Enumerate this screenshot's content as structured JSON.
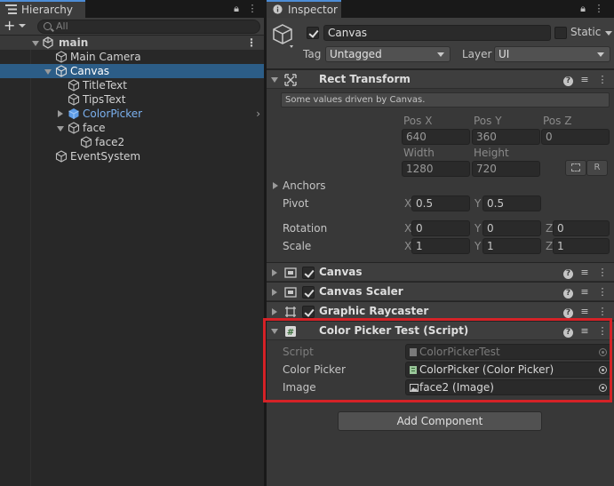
{
  "hierarchy": {
    "tab_label": "Hierarchy",
    "search_placeholder": "All",
    "scene": {
      "name": "main"
    },
    "items": [
      {
        "label": "Main Camera"
      },
      {
        "label": "Canvas"
      },
      {
        "label": "TitleText"
      },
      {
        "label": "TipsText"
      },
      {
        "label": "ColorPicker"
      },
      {
        "label": "face"
      },
      {
        "label": "face2"
      },
      {
        "label": "EventSystem"
      }
    ]
  },
  "inspector": {
    "tab_label": "Inspector",
    "object": {
      "name": "Canvas",
      "active": true,
      "static_label": "Static",
      "tag_label": "Tag",
      "tag_value": "Untagged",
      "layer_label": "Layer",
      "layer_value": "UI"
    },
    "rect_transform": {
      "title": "Rect Transform",
      "info": "Some values driven by Canvas.",
      "pos_x_label": "Pos X",
      "pos_x": "640",
      "pos_y_label": "Pos Y",
      "pos_y": "360",
      "pos_z_label": "Pos Z",
      "pos_z": "0",
      "width_label": "Width",
      "width": "1280",
      "height_label": "Height",
      "height": "720",
      "r_button": "R",
      "anchors_label": "Anchors",
      "pivot_label": "Pivot",
      "pivot_x": "0.5",
      "pivot_y": "0.5",
      "rotation_label": "Rotation",
      "rot_x": "0",
      "rot_y": "0",
      "rot_z": "0",
      "scale_label": "Scale",
      "scale_x": "1",
      "scale_y": "1",
      "scale_z": "1",
      "axis_x": "X",
      "axis_y": "Y",
      "axis_z": "Z"
    },
    "components": [
      {
        "title": "Canvas"
      },
      {
        "title": "Canvas Scaler"
      },
      {
        "title": "Graphic Raycaster"
      }
    ],
    "script_component": {
      "title": "Color Picker Test (Script)",
      "script_label": "Script",
      "script_value": "ColorPickerTest",
      "color_picker_label": "Color Picker",
      "color_picker_value": "ColorPicker (Color Picker)",
      "image_label": "Image",
      "image_value": "face2 (Image)"
    },
    "add_component_label": "Add Component"
  },
  "colors": {
    "selection": "#2c5d87",
    "highlight_border": "#d52227",
    "prefab_blue": "#7bb1ef",
    "tab_accent": "#4d8dd6"
  }
}
